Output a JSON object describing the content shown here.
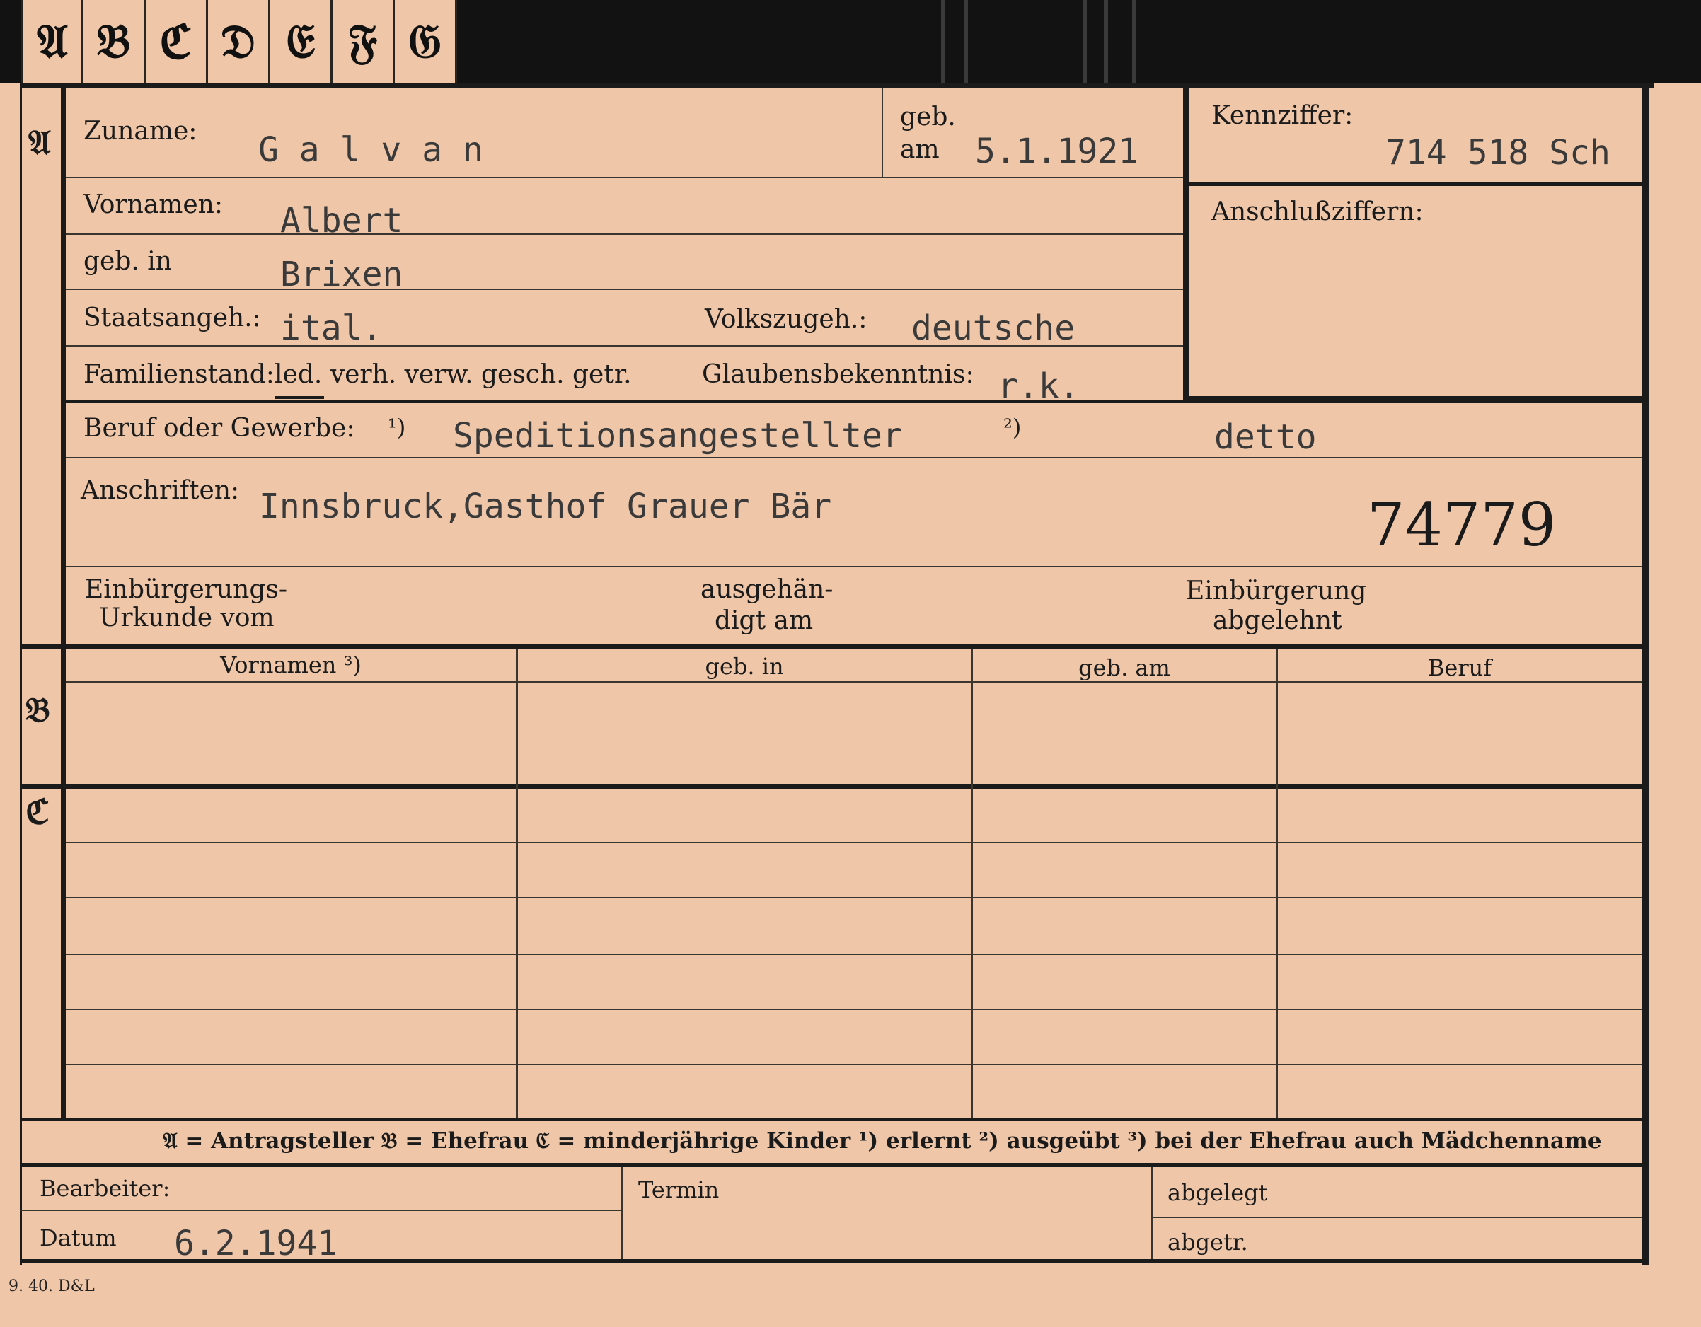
{
  "tabs": [
    "𝔄",
    "𝔅",
    "ℭ",
    "𝔇",
    "𝔈",
    "𝔉",
    "𝔊"
  ],
  "sections": {
    "a": "𝔄",
    "b": "𝔅",
    "c": "ℭ"
  },
  "fields": {
    "surname_label": "Zuname:",
    "surname_value": "G a l v a n",
    "born_label_1": "geb.",
    "born_label_2": "am",
    "born_value": "5.1.1921",
    "id_label": "Kennziffer:",
    "id_value": "714 518  Sch",
    "link_label": "Anschlußziffern:",
    "first_label": "Vornamen:",
    "first_value": "Albert",
    "birthplace_label": "geb. in",
    "birthplace_value": "Brixen",
    "citizenship_label": "Staatsangeh.:",
    "citizenship_value": "ital.",
    "ethnicity_label": "Volkszugeh.:",
    "ethnicity_value": "deutsche",
    "family_label": "Familienstand:",
    "family_options": "led. verh. verw. gesch. getr.",
    "religion_label": "Glaubensbekenntnis:",
    "religion_value": "r.k.",
    "profession_label": "Beruf oder Gewerbe:",
    "profession_mark1": "¹)",
    "profession_value": "Speditionsangestellter",
    "profession_mark2": "²)",
    "profession_value2": "detto",
    "address_label": "Anschriften:",
    "address_value": "Innsbruck,Gasthof Grauer Bär",
    "stamp_number": "74779",
    "naturalization_label_1": "Einbürgerungs-",
    "naturalization_label_2": "Urkunde vom",
    "handed_label_1": "ausgehän-",
    "handed_label_2": "digt am",
    "rejected_label_1": "Einbürgerung",
    "rejected_label_2": "abgelehnt"
  },
  "table_headers": [
    "Vornamen ³)",
    "geb. in",
    "geb. am",
    "Beruf"
  ],
  "legend": "𝔄 = Antragsteller   𝔅 = Ehefrau   ℭ = minderjährige Kinder   ¹) erlernt   ²) ausgeübt   ³) bei der Ehefrau auch Mädchenname",
  "footer": {
    "clerk_label": "Bearbeiter:",
    "date_label": "Datum",
    "date_value": "6.2.1941",
    "deadline_label": "Termin",
    "filed_label": "abgelegt",
    "separated_label": "abgetr."
  },
  "print_mark": "9. 40. D&L",
  "colors": {
    "paper": "#efc6a7",
    "ink": "#1b1b1b",
    "typewriter": "#3a3a3a",
    "top_background": "#121212"
  }
}
